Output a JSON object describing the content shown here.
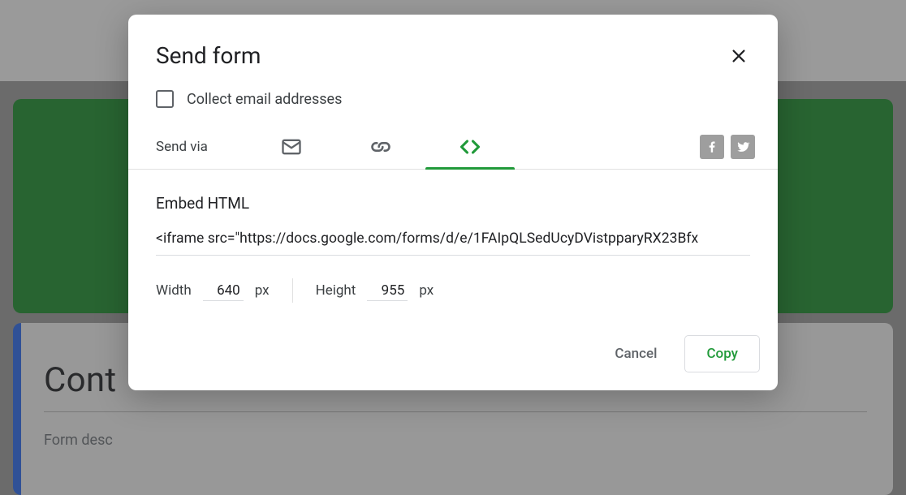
{
  "background": {
    "card_title": "Cont",
    "card_desc": "Form desc"
  },
  "dialog": {
    "title": "Send form",
    "collect_label": "Collect email addresses",
    "send_via_label": "Send via",
    "embed": {
      "title": "Embed HTML",
      "code": "<iframe src=\"https://docs.google.com/forms/d/e/1FAIpQLSedUcyDVistpparyRX23Bfx"
    },
    "dimensions": {
      "width_label": "Width",
      "width_value": "640",
      "width_unit": "px",
      "height_label": "Height",
      "height_value": "955",
      "height_unit": "px"
    },
    "buttons": {
      "cancel": "Cancel",
      "copy": "Copy"
    }
  },
  "colors": {
    "accent": "#219a3a"
  }
}
